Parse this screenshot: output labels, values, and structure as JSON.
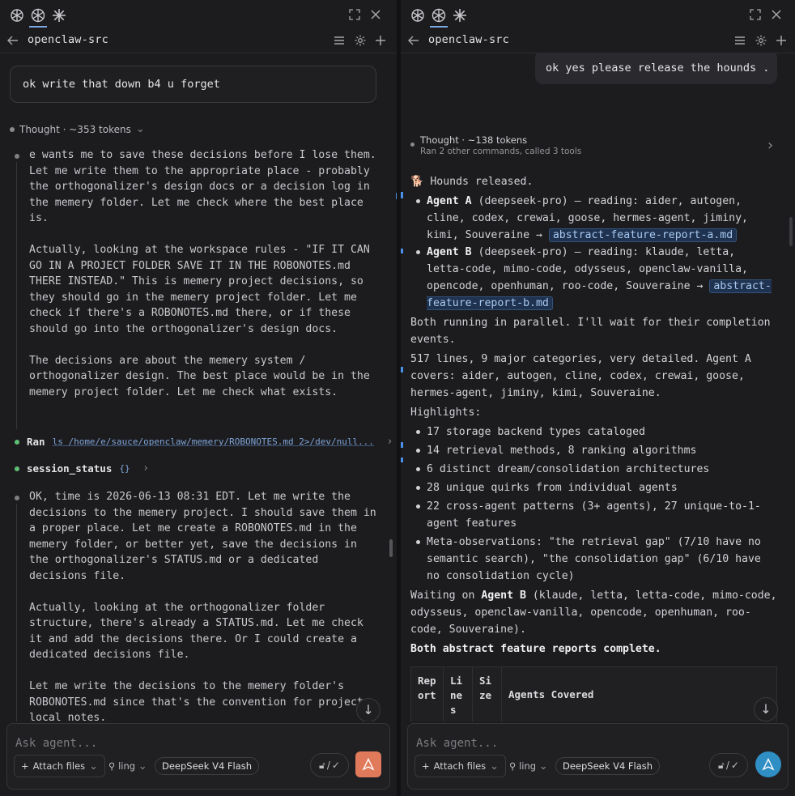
{
  "left": {
    "nav_title": "openclaw-src",
    "user_message": "ok write that down b4 u forget",
    "thought_label": "Thought · ~353 tokens",
    "reasoning_1": "e wants me to save these decisions before I lose them. Let me write them to the appropriate place - probably the orthogonalizer's design docs or a decision log in the memery folder. Let me check where the best place is.\n\nActually, looking at the workspace rules - \"IF IT CAN GO IN A PROJECT FOLDER SAVE IT IN THE ROBONOTES.md THERE INSTEAD.\" This is memery project decisions, so they should go in the memery project folder. Let me check if there's a ROBONOTES.md there, or if these should go into the orthogonalizer's design docs.\n\nThe decisions are about the memery system / orthogonalizer design. The best place would be in the memery project folder. Let me check what exists.",
    "tool_ran_label": "Ran",
    "tool_ran_cmd": "ls /home/e/sauce/openclaw/memery/ROBONOTES.md 2>/dev/null...",
    "tool_status_label": "session_status",
    "tool_status_args": "{}",
    "reasoning_2": "OK, time is 2026-06-13 08:31 EDT. Let me write the decisions to the memery project. I should save them in a proper place. Let me create a ROBONOTES.md in the memery folder, or better yet, save the decisions in the orthogonalizer's STATUS.md or a dedicated decisions file.\n\nActually, looking at the orthogonalizer folder structure, there's already a STATUS.md. Let me check it and add the decisions there. Or I could create a dedicated decisions file.\n\nLet me write the decisions to the memery folder's ROBONOTES.md since that's the convention for project-local notes.",
    "composer_placeholder": "Ask agent...",
    "attach_label": "Attach files",
    "ling_label": "ling",
    "model_label": "DeepSeek V4 Flash",
    "perm_label": "/"
  },
  "right": {
    "nav_title": "openclaw-src",
    "user_message": "ok yes please release the hounds .",
    "thought_label": "Thought · ~138 tokens",
    "thought_sub": "Ran 2 other commands, called 3 tools",
    "hounds": "🐕 Hounds released.",
    "agentA_name": "Agent A",
    "agentA_rest": " (deepseek-pro) — reading: aider, autogen, cline, codex, crewai, goose, hermes-agent, jiminy, kimi, Souveraine → ",
    "agentA_file": "abstract-feature-report-a.md",
    "agentB_name": "Agent B",
    "agentB_rest": " (deepseek-pro) — reading: klaude, letta, letta-code, mimo-code, odysseus, openclaw-vanilla, opencode, openhuman, roo-code, Souveraine → ",
    "agentB_file": "abstract-feature-report-b.md",
    "parallel": "Both running in parallel. I'll wait for their completion events.",
    "summary": "517 lines, 9 major categories, very detailed. Agent A covers: aider, autogen, cline, codex, crewai, goose, hermes-agent, jiminy, kimi, Souveraine.",
    "highlights_label": "Highlights:",
    "highlights": [
      "17 storage backend types cataloged",
      "14 retrieval methods, 8 ranking algorithms",
      "6 distinct dream/consolidation architectures",
      "28 unique quirks from individual agents",
      "22 cross-agent patterns (3+ agents), 27 unique-to-1-agent features",
      "Meta-observations: \"the retrieval gap\" (7/10 have no semantic search), \"the consolidation gap\" (6/10 have no consolidation cycle)"
    ],
    "waiting_pre": "Waiting on ",
    "waiting_agent": "Agent B",
    "waiting_rest": " (klaude, letta, letta-code, mimo-code, odysseus, openclaw-vanilla, opencode, openhuman, roo-code, Souveraine).",
    "complete": "Both abstract feature reports complete.",
    "table_headers": [
      "Rep ort",
      "Li ne s",
      "Si ze",
      "Agents Covered"
    ],
    "composer_placeholder": "Ask agent...",
    "attach_label": "Attach files",
    "ling_label": "ling",
    "model_label": "DeepSeek V4 Flash",
    "perm_label": "/"
  },
  "colors": {
    "accent": "#7aa9e6",
    "send_left": "#e07a5a",
    "send_right": "#2f8fc4",
    "status_green": "#5fbf73"
  }
}
